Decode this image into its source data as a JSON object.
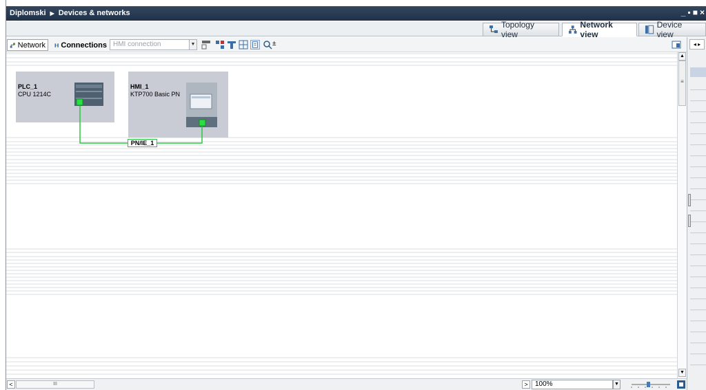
{
  "window": {
    "breadcrumb": [
      "Diplomski",
      "Devices & networks"
    ],
    "controls": [
      "_",
      "▪",
      "■",
      "×"
    ]
  },
  "view_tabs": [
    {
      "label": "Topology view",
      "active": false
    },
    {
      "label": "Network view",
      "active": true
    },
    {
      "label": "Device view",
      "active": false
    }
  ],
  "toolbar": {
    "network_label": "Network",
    "connections_label": "Connections",
    "connection_type_value": "HMI connection"
  },
  "devices": [
    {
      "name": "PLC_1",
      "type": "CPU 1214C"
    },
    {
      "name": "HMI_1",
      "type": "KTP700 Basic PN"
    }
  ],
  "network": {
    "label": "PN/IE_1",
    "color": "#28c840"
  },
  "statusbar": {
    "zoom_value": "100%",
    "scroll_grip": "III"
  },
  "colors": {
    "title_bar": "#25384f",
    "device_box": "#c9ccd4",
    "link_green": "#28c840"
  }
}
